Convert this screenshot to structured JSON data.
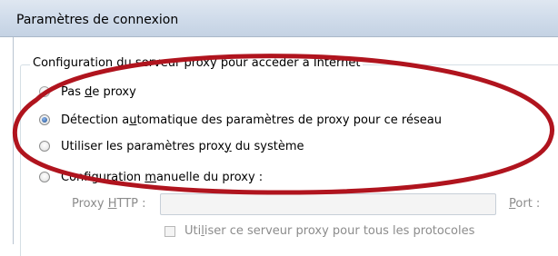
{
  "window": {
    "title": "Paramètres de connexion"
  },
  "proxy_group": {
    "legend": "Configuration du serveur proxy pour accéder à Internet",
    "options": [
      {
        "pre": "Pas ",
        "mnemonic": "d",
        "post": "e proxy",
        "checked": false
      },
      {
        "pre": "Détection a",
        "mnemonic": "u",
        "post": "tomatique des paramètres de proxy pour ce réseau",
        "checked": true
      },
      {
        "pre": "Utiliser les paramètres prox",
        "mnemonic": "y",
        "post": " du système",
        "checked": false
      },
      {
        "pre": "Configuration ",
        "mnemonic": "m",
        "post": "anuelle du proxy :",
        "checked": false
      }
    ]
  },
  "manual": {
    "http_label_pre": "Proxy ",
    "http_label_mnemonic": "H",
    "http_label_post": "TTP :",
    "http_value": "",
    "port_label_mnemonic": "P",
    "port_label_post": "ort :",
    "same_proxy_pre": "Uti",
    "same_proxy_mnemonic": "l",
    "same_proxy_post": "iser ce serveur proxy pour tous les protocoles",
    "same_proxy_checked": false
  },
  "annotation": {
    "color": "#b0141e",
    "shape": "ellipse"
  }
}
